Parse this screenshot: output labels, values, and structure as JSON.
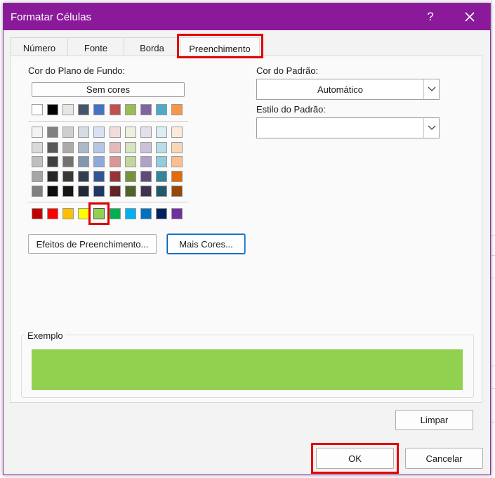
{
  "dialog": {
    "title": "Formatar Células",
    "help_label": "?",
    "close_label": "✕"
  },
  "tabs": [
    {
      "label": "Número"
    },
    {
      "label": "Fonte"
    },
    {
      "label": "Borda"
    },
    {
      "label": "Preenchimento",
      "active": true
    }
  ],
  "background_color": {
    "label": "Cor do Plano de Fundo:",
    "no_color_label": "Sem cores",
    "theme_row": [
      "#FFFFFF",
      "#000000",
      "#E7E6E6",
      "#44546A",
      "#4472C4",
      "#C0504D",
      "#9BBB59",
      "#8064A2",
      "#4BACC6",
      "#F79646"
    ],
    "shade_rows": [
      [
        "#F2F2F2",
        "#808080",
        "#D0CECE",
        "#D6DCE4",
        "#D9E1F2",
        "#F2DCDB",
        "#EBF1DE",
        "#E4DFEC",
        "#DAEEF3",
        "#FDE9D9"
      ],
      [
        "#D9D9D9",
        "#595959",
        "#AEAAAA",
        "#ACB9CA",
        "#B4C6E7",
        "#E6B8B7",
        "#D8E4BC",
        "#CCC0DA",
        "#B7DEE8",
        "#FCD5B4"
      ],
      [
        "#BFBFBF",
        "#404040",
        "#757171",
        "#8497B0",
        "#8EA9DB",
        "#DA9694",
        "#C4D79B",
        "#B1A0C7",
        "#92CDDC",
        "#FABF8F"
      ],
      [
        "#A6A6A6",
        "#262626",
        "#3A3838",
        "#333F4F",
        "#305496",
        "#963634",
        "#76933C",
        "#60497A",
        "#31869B",
        "#E26B0A"
      ],
      [
        "#808080",
        "#0D0D0D",
        "#161616",
        "#222B35",
        "#203764",
        "#632523",
        "#4F6228",
        "#403151",
        "#215967",
        "#974706"
      ]
    ],
    "standard_row": [
      "#C00000",
      "#FF0000",
      "#FFC000",
      "#FFFF00",
      "#92D050",
      "#00B050",
      "#00B0F0",
      "#0070C0",
      "#002060",
      "#7030A0"
    ],
    "selected_standard_index": 4,
    "fill_effects_label": "Efeitos de Preenchimento...",
    "more_colors_label": "Mais Cores..."
  },
  "pattern": {
    "color_label": "Cor do Padrão:",
    "color_value": "Automático",
    "style_label": "Estilo do Padrão:",
    "style_value": ""
  },
  "example": {
    "label": "Exemplo",
    "fill_color": "#92D050"
  },
  "buttons": {
    "clear_label": "Limpar",
    "ok_label": "OK",
    "cancel_label": "Cancelar"
  },
  "colors": {
    "titlebar": "#8B1A9B",
    "highlight": "#E00000"
  }
}
